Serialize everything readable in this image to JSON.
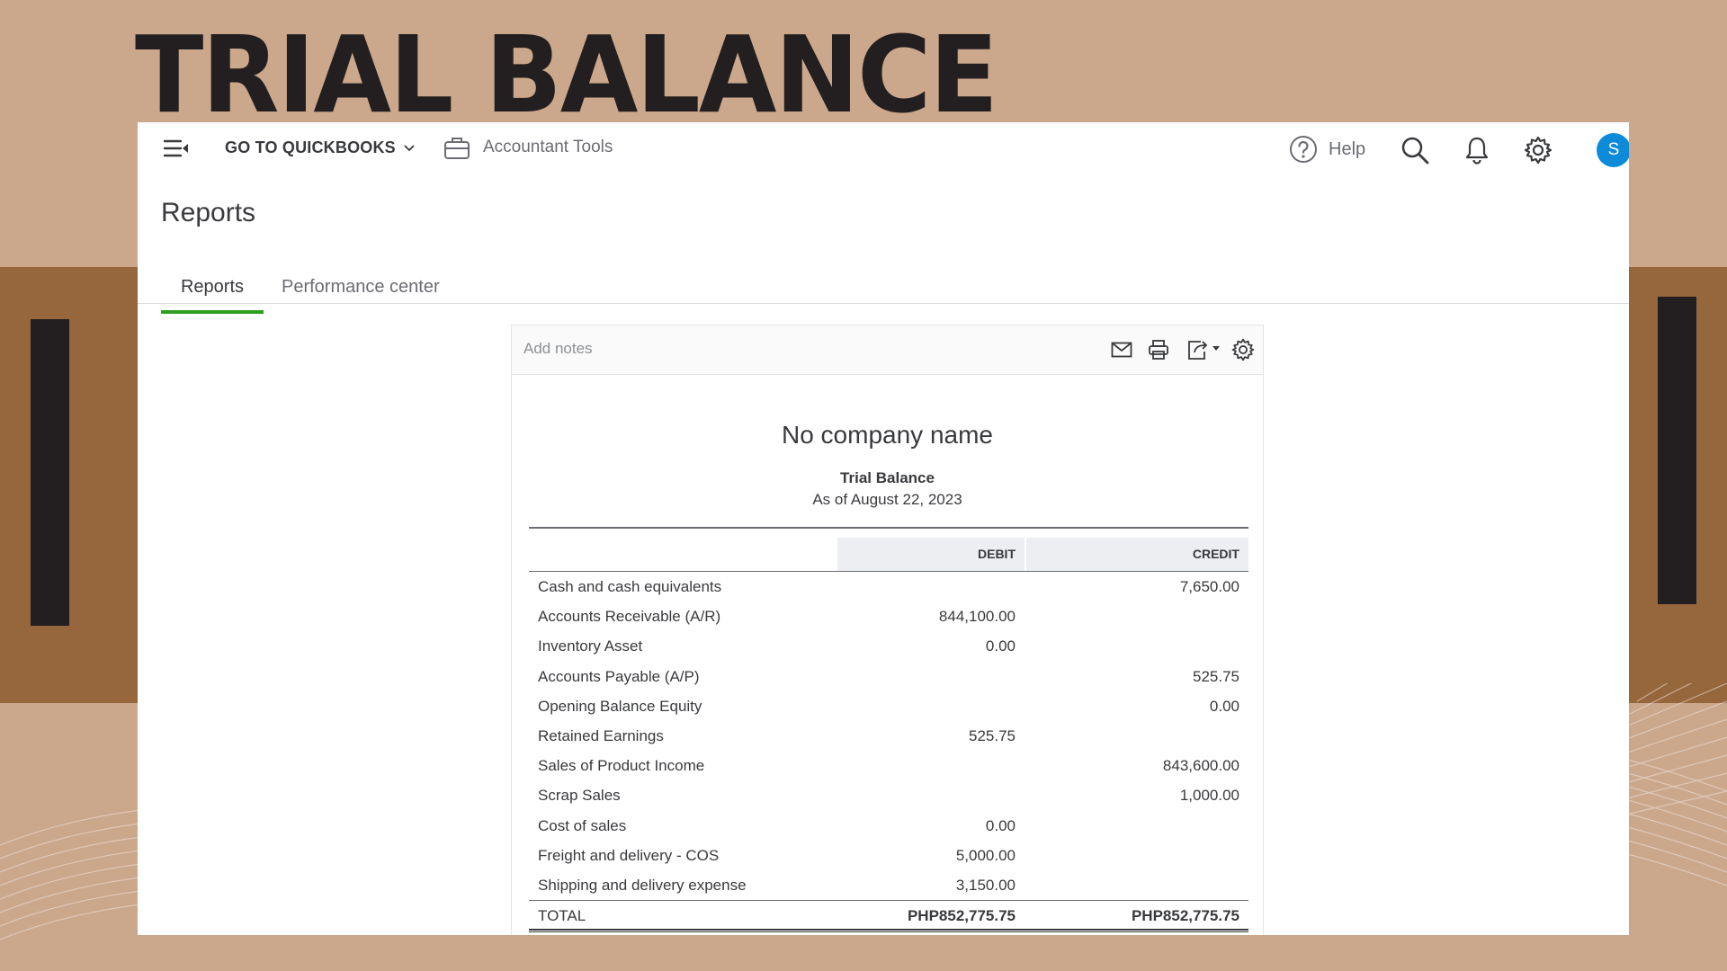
{
  "slide": {
    "title": "TRIAL BALANCE"
  },
  "topnav": {
    "goto_label": "GO TO QUICKBOOKS",
    "accountant_tools_label": "Accountant Tools",
    "help_label": "Help",
    "avatar_initial": "S"
  },
  "page": {
    "title": "Reports",
    "tabs": [
      {
        "label": "Reports",
        "active": true
      },
      {
        "label": "Performance center",
        "active": false
      }
    ]
  },
  "report": {
    "notes_placeholder": "Add notes",
    "company_name": "No company name",
    "title": "Trial Balance",
    "date": "As of August 22, 2023",
    "columns": {
      "debit": "DEBIT",
      "credit": "CREDIT"
    },
    "rows": [
      {
        "account": "Cash and cash equivalents",
        "debit": "",
        "credit": "7,650.00"
      },
      {
        "account": "Accounts Receivable (A/R)",
        "debit": "844,100.00",
        "credit": ""
      },
      {
        "account": "Inventory Asset",
        "debit": "0.00",
        "credit": ""
      },
      {
        "account": "Accounts Payable (A/P)",
        "debit": "",
        "credit": "525.75"
      },
      {
        "account": "Opening Balance Equity",
        "debit": "",
        "credit": "0.00"
      },
      {
        "account": "Retained Earnings",
        "debit": "525.75",
        "credit": ""
      },
      {
        "account": "Sales of Product Income",
        "debit": "",
        "credit": "843,600.00"
      },
      {
        "account": "Scrap Sales",
        "debit": "",
        "credit": "1,000.00"
      },
      {
        "account": "Cost of sales",
        "debit": "0.00",
        "credit": ""
      },
      {
        "account": "Freight and delivery - COS",
        "debit": "5,000.00",
        "credit": ""
      },
      {
        "account": "Shipping and delivery expense",
        "debit": "3,150.00",
        "credit": ""
      }
    ],
    "total": {
      "label": "TOTAL",
      "debit": "PHP852,775.75",
      "credit": "PHP852,775.75"
    }
  },
  "colors": {
    "background": "#cba78c",
    "band": "#96663c",
    "accent_bar": "#231f20",
    "tab_active": "#2ca01c",
    "avatar": "#0d8bd9"
  },
  "icons": [
    "menu-icon",
    "chevron-down-icon",
    "briefcase-icon",
    "help-icon",
    "search-icon",
    "bell-icon",
    "gear-icon",
    "mail-icon",
    "print-icon",
    "export-icon"
  ]
}
